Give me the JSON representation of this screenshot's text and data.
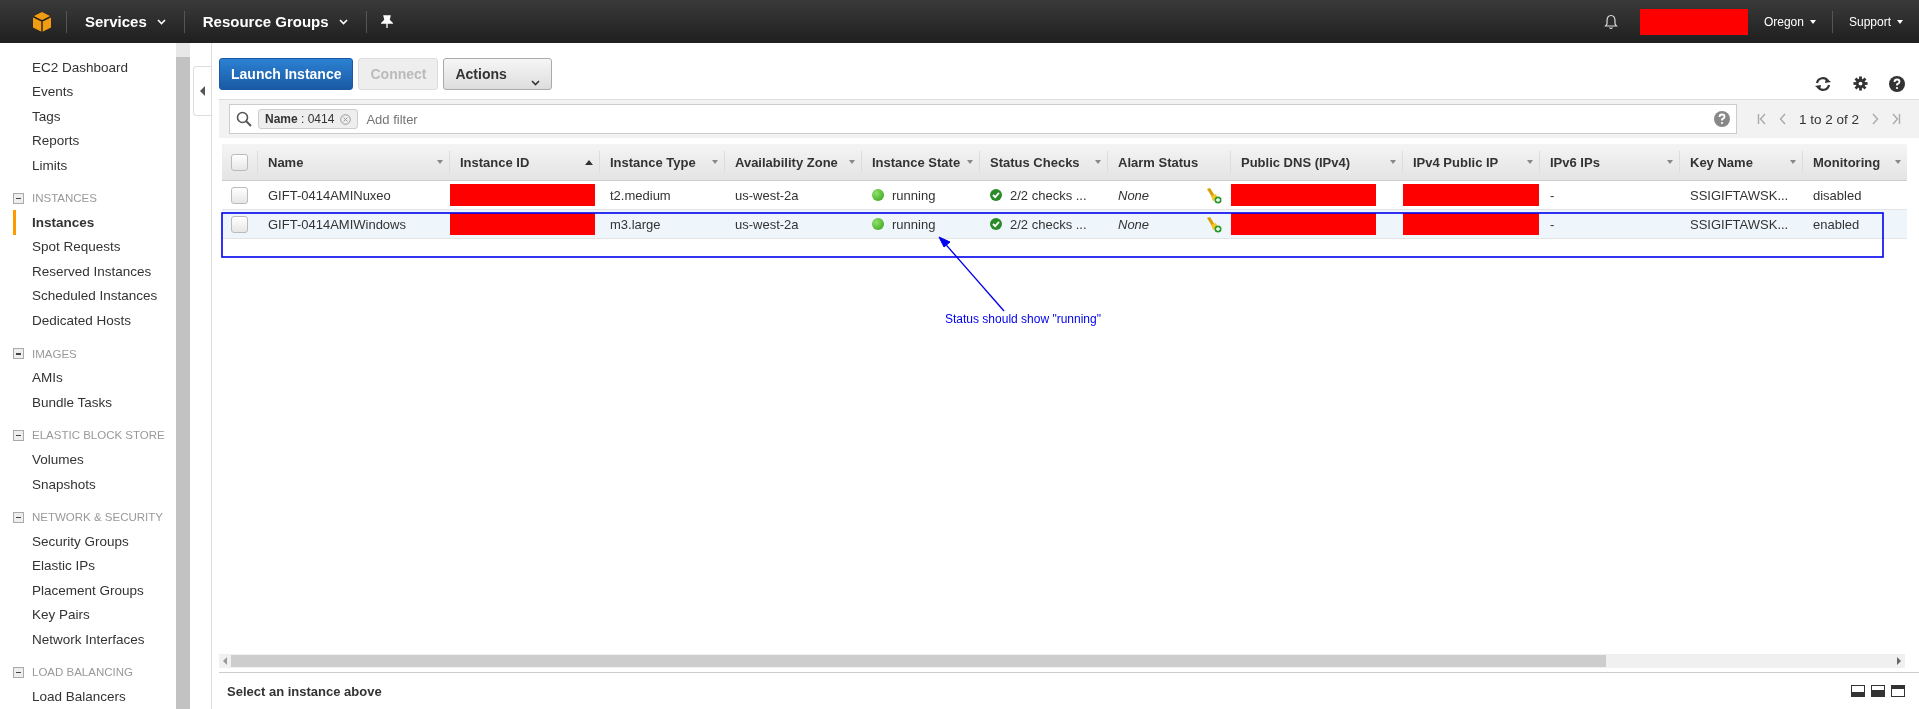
{
  "top_nav": {
    "menus": [
      {
        "label": "Services"
      },
      {
        "label": "Resource Groups"
      }
    ],
    "account_redacted": true,
    "region": "Oregon",
    "support": "Support"
  },
  "sidebar": {
    "items": [
      {
        "label": "EC2 Dashboard",
        "selected": false
      },
      {
        "label": "Events",
        "selected": false
      },
      {
        "label": "Tags",
        "selected": false
      },
      {
        "label": "Reports",
        "selected": false
      },
      {
        "label": "Limits",
        "selected": false
      }
    ],
    "groups": [
      {
        "heading": "INSTANCES",
        "expanded": true,
        "items": [
          {
            "label": "Instances",
            "selected": true
          },
          {
            "label": "Spot Requests",
            "selected": false
          },
          {
            "label": "Reserved Instances",
            "selected": false
          },
          {
            "label": "Scheduled Instances",
            "selected": false
          },
          {
            "label": "Dedicated Hosts",
            "selected": false
          }
        ]
      },
      {
        "heading": "IMAGES",
        "expanded": true,
        "items": [
          {
            "label": "AMIs",
            "selected": false
          },
          {
            "label": "Bundle Tasks",
            "selected": false
          }
        ]
      },
      {
        "heading": "ELASTIC BLOCK STORE",
        "expanded": true,
        "items": [
          {
            "label": "Volumes",
            "selected": false
          },
          {
            "label": "Snapshots",
            "selected": false
          }
        ]
      },
      {
        "heading": "NETWORK & SECURITY",
        "expanded": true,
        "items": [
          {
            "label": "Security Groups",
            "selected": false
          },
          {
            "label": "Elastic IPs",
            "selected": false
          },
          {
            "label": "Placement Groups",
            "selected": false
          },
          {
            "label": "Key Pairs",
            "selected": false
          },
          {
            "label": "Network Interfaces",
            "selected": false
          }
        ]
      },
      {
        "heading": "LOAD BALANCING",
        "expanded": true,
        "items": [
          {
            "label": "Load Balancers",
            "selected": false
          }
        ]
      }
    ]
  },
  "toolbar": {
    "buttons": [
      {
        "label": "Launch Instance",
        "kind": "primary",
        "disabled": false
      },
      {
        "label": "Connect",
        "kind": "default",
        "disabled": true
      },
      {
        "label": "Actions",
        "kind": "menu",
        "disabled": false
      }
    ]
  },
  "filter": {
    "tags": [
      {
        "text": "**Name** : 0414"
      }
    ],
    "placeholder": "Add filter"
  },
  "pagination": {
    "range": "1 to 2 of 2"
  },
  "table": {
    "all_checked": false,
    "columns": [
      {
        "label": "Name",
        "kind": "menu"
      },
      {
        "label": "Instance ID",
        "kind": "sorted"
      },
      {
        "label": "Instance Type",
        "kind": "menu"
      },
      {
        "label": "Availability Zone",
        "kind": "menu"
      },
      {
        "label": "Instance State",
        "kind": "menu"
      },
      {
        "label": "Status Checks",
        "kind": "menu"
      },
      {
        "label": "Alarm Status",
        "kind": "plain"
      },
      {
        "label": "Public DNS (IPv4)",
        "kind": "menu"
      },
      {
        "label": "IPv4 Public IP",
        "kind": "menu"
      },
      {
        "label": "IPv6 IPs",
        "kind": "menu"
      },
      {
        "label": "Key Name",
        "kind": "menu"
      },
      {
        "label": "Monitoring",
        "kind": "menu"
      }
    ],
    "rows": [
      {
        "selected": false,
        "checked": false,
        "cells": [
          {
            "kind": "text",
            "text": "GIFT-0414AMINuxeo"
          },
          {
            "kind": "redacted"
          },
          {
            "kind": "text",
            "text": "t2.medium"
          },
          {
            "kind": "text",
            "text": "us-west-2a"
          },
          {
            "kind": "state",
            "text": "running"
          },
          {
            "kind": "check",
            "text": "2/2 checks ..."
          },
          {
            "kind": "alarm",
            "text": "None"
          },
          {
            "kind": "redacted"
          },
          {
            "kind": "redacted"
          },
          {
            "kind": "text",
            "text": "-"
          },
          {
            "kind": "text",
            "text": "SSIGIFTAWSK..."
          },
          {
            "kind": "text",
            "text": "disabled"
          }
        ]
      },
      {
        "selected": true,
        "checked": false,
        "cells": [
          {
            "kind": "text",
            "text": "GIFT-0414AMIWindows"
          },
          {
            "kind": "redacted"
          },
          {
            "kind": "text",
            "text": "m3.large"
          },
          {
            "kind": "text",
            "text": "us-west-2a"
          },
          {
            "kind": "state",
            "text": "running"
          },
          {
            "kind": "check",
            "text": "2/2 checks ..."
          },
          {
            "kind": "alarm",
            "text": "None"
          },
          {
            "kind": "redacted"
          },
          {
            "kind": "redacted"
          },
          {
            "kind": "text",
            "text": "-"
          },
          {
            "kind": "text",
            "text": "SSIGIFTAWSK..."
          },
          {
            "kind": "text",
            "text": "enabled"
          }
        ]
      }
    ]
  },
  "annotation": {
    "text": "Status should show \"running\""
  },
  "details_pane": {
    "message": "Select an instance above"
  }
}
